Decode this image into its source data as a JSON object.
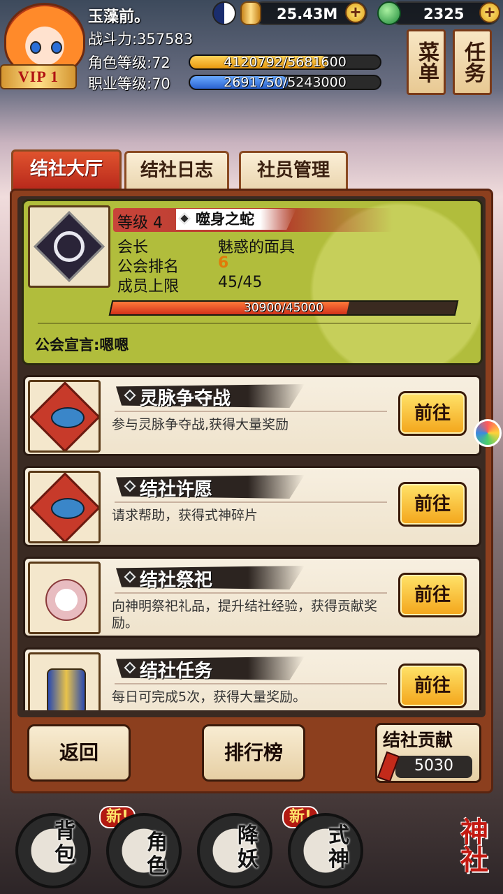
{
  "header": {
    "player_name": "玉藻前。",
    "power": "战斗力:357583",
    "vip": "VIP 1",
    "role_level_label": "角色等级:72",
    "role_exp": "4120792/5681600",
    "role_exp_fraction": 0.725,
    "job_level_label": "职业等级:70",
    "job_exp": "2691750/5243000",
    "job_exp_fraction": 0.513,
    "coins": "25.43M",
    "jade": "2325",
    "menu_btn": "菜单",
    "task_btn": "任务"
  },
  "tabs": [
    {
      "label": "结社大厅",
      "active": true
    },
    {
      "label": "结社日志",
      "active": false
    },
    {
      "label": "社员管理",
      "active": false
    }
  ],
  "guild": {
    "level": "等级 4",
    "name": "噬身之蛇",
    "leader_label": "会长",
    "leader_value": "魅惑的面具",
    "rank_label": "公会排名",
    "rank_value": "6",
    "member_label": "成员上限",
    "member_value": "45/45",
    "exp_text": "30900/45000",
    "exp_fraction": 0.687,
    "declaration": "公会宣言:嗯嗯"
  },
  "features": [
    {
      "title": "灵脉争夺战",
      "desc": "参与灵脉争夺战,获得大量奖励",
      "button": "前往",
      "icon": "fan-fish-icon"
    },
    {
      "title": "结社许愿",
      "desc": "请求帮助，获得式神碎片",
      "button": "前往",
      "icon": "fan-fish-icon"
    },
    {
      "title": "结社祭祀",
      "desc": "向神明祭祀礼品，提升结社经验，获得贡献奖励。",
      "button": "前往",
      "icon": "offering-icon"
    },
    {
      "title": "结社任务",
      "desc": "每日可完成5次，获得大量奖励。",
      "button": "前往",
      "icon": "scroll-icon"
    }
  ],
  "bottom": {
    "back": "返回",
    "ranking": "排行榜",
    "contribution_label": "结社贡献",
    "contribution_value": "5030"
  },
  "nav": {
    "new_tag": "新!",
    "bag": "背包",
    "role": "角色",
    "demon": "降妖",
    "shikigami": "式神",
    "shrine": "神社"
  },
  "colors": {
    "accent_red": "#b7281b",
    "panel_brown": "#8c3f1e",
    "guild_card_green": "#b1bd3c",
    "go_button_yellow": "#f3a51a"
  }
}
